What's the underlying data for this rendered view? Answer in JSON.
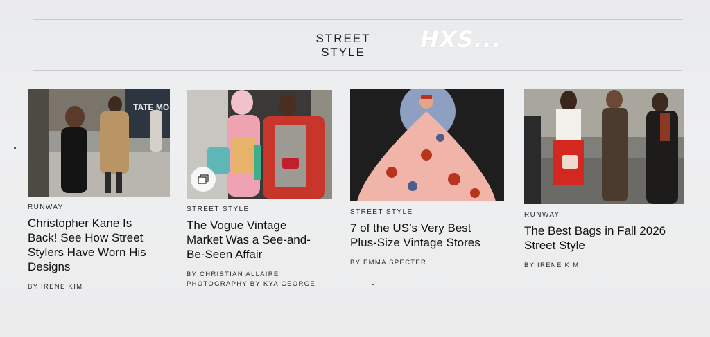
{
  "section": {
    "title_line1": "STREET",
    "title_line2": "STYLE"
  },
  "watermark": "HXS...",
  "cards": [
    {
      "kicker": "RUNWAY",
      "headline": "Christopher Kane Is Back! See How Street Stylers Have Worn His Designs",
      "byline1": "BY IRENE KIM",
      "image": "street-style-photo-two-women-sidewalk"
    },
    {
      "kicker": "STREET STYLE",
      "headline": "The Vogue Vintage Market Was a See-and-Be-Seen Affair",
      "byline1": "BY CHRISTIAN ALLAIRE",
      "byline2": "PHOTOGRAPHY BY KYA GEORGE",
      "image": "two-women-colorful-outfits",
      "gallery_icon": "gallery-icon"
    },
    {
      "kicker": "STREET STYLE",
      "headline": "7 of the US’s Very Best Plus-Size Vintage Stores",
      "byline1": "BY EMMA SPECTER",
      "image": "illustration-woman-pink-gown"
    },
    {
      "kicker": "RUNWAY",
      "headline": "The Best Bags in Fall 2026 Street Style",
      "byline1": "BY IRENE KIM",
      "image": "group-street-style-red-skirt"
    }
  ]
}
